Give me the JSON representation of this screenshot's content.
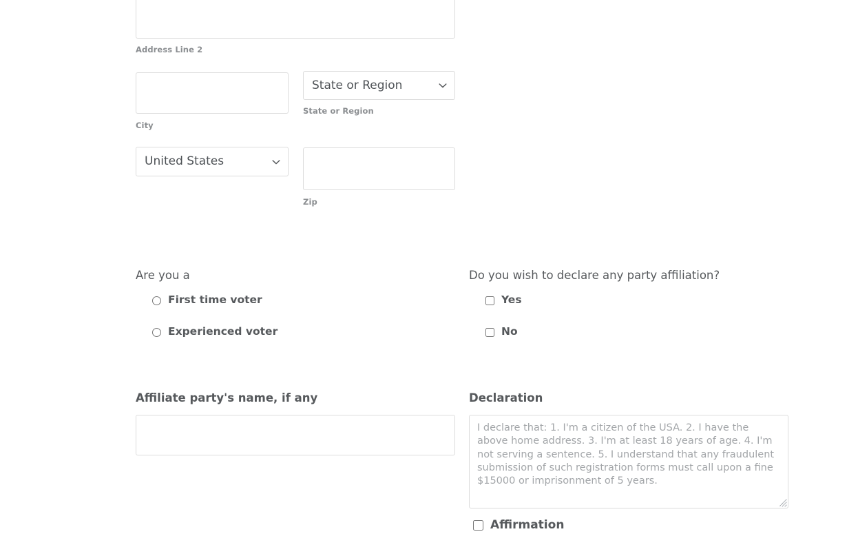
{
  "form": {
    "address": {
      "address_line2": {
        "value": "",
        "placeholder": "",
        "caption": "Address Line 2"
      },
      "city": {
        "value": "",
        "placeholder": "",
        "caption": "City"
      },
      "state_or_region": {
        "selected": "State or Region",
        "caption": "State or Region",
        "options": [
          "State or Region"
        ]
      },
      "country": {
        "selected": "United States",
        "caption": "",
        "options": [
          "United States"
        ]
      },
      "zip": {
        "value": "",
        "placeholder": "",
        "caption": "Zip"
      }
    },
    "voter_type": {
      "question": "Are you a",
      "options": [
        {
          "label": "First time voter",
          "checked": false
        },
        {
          "label": "Experienced voter",
          "checked": false
        }
      ]
    },
    "party_affiliation": {
      "question": "Do you wish to declare any party affiliation?",
      "options": [
        {
          "label": "Yes",
          "checked": false
        },
        {
          "label": "No",
          "checked": false
        }
      ]
    },
    "affiliate_party": {
      "title": "Affiliate party's name, if any",
      "value": "",
      "placeholder": ""
    },
    "declaration": {
      "title": "Declaration",
      "value": "",
      "placeholder": "I declare that: 1. I'm a citizen of the USA. 2. I have the above home address. 3. I'm at least 18 years of age. 4. I'm not serving a sentence. 5. I understand that any fraudulent submission of such registration forms must call upon a fine $15000 or imprisonment of 5 years."
    },
    "affirmation": {
      "label": "Affirmation",
      "checked": false
    }
  },
  "icons": {
    "chevron_down": "chevron-down-icon",
    "resize_grip": "resize-grip-icon"
  },
  "colors": {
    "text": "#56595c",
    "caption": "#8b8e91",
    "border": "#dcdcdc",
    "placeholder": "#a3a6a9",
    "background": "#ffffff"
  }
}
